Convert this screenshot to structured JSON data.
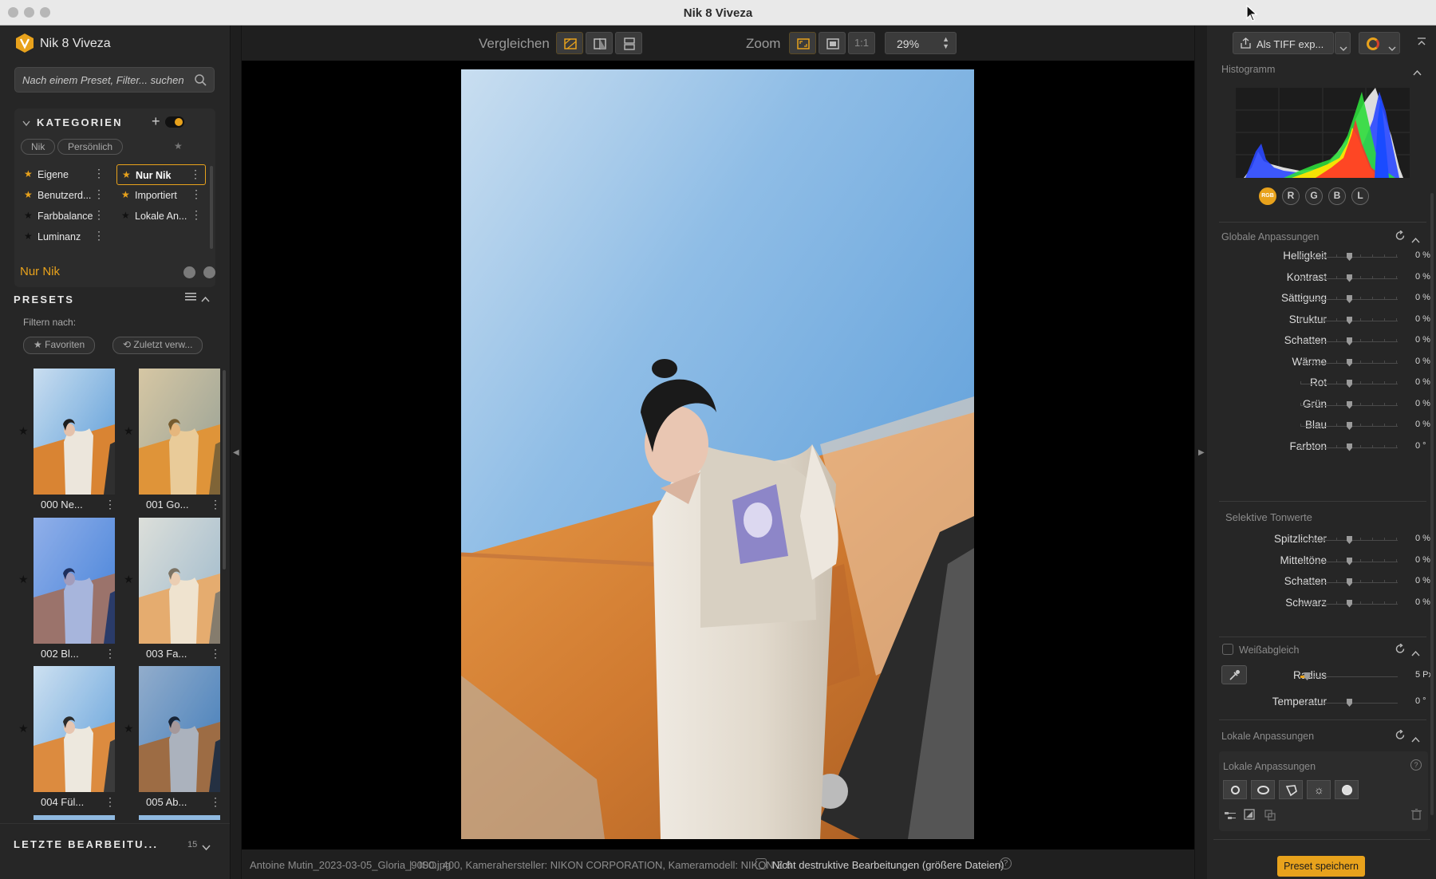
{
  "window": {
    "title": "Nik 8 Viveza"
  },
  "left": {
    "app_name": "Nik 8 Viveza",
    "search_placeholder": "Nach einem Preset, Filter... suchen",
    "categories_title": "KATEGORIEN",
    "chips": [
      "Nik",
      "Persönlich"
    ],
    "categories": [
      {
        "label": "Eigene",
        "star": "orange",
        "active": false
      },
      {
        "label": "Nur Nik",
        "star": "orange",
        "active": true
      },
      {
        "label": "Benutzerd...",
        "star": "orange",
        "active": false
      },
      {
        "label": "Importiert",
        "star": "orange",
        "active": false
      },
      {
        "label": "Farbbalance",
        "star": "dark",
        "active": false
      },
      {
        "label": "Lokale An...",
        "star": "dark",
        "active": false
      },
      {
        "label": "Luminanz",
        "star": "dark",
        "active": false
      }
    ],
    "current_category": "Nur Nik",
    "presets_title": "PRESETS",
    "filter_label": "Filtern nach:",
    "filter_chips": [
      "Favoriten",
      "Zuletzt verw..."
    ],
    "thumbnails": [
      {
        "label": "000 Ne...",
        "tone": "neutral"
      },
      {
        "label": "001 Go...",
        "tone": "gold"
      },
      {
        "label": "002 Bl...",
        "tone": "blue"
      },
      {
        "label": "003 Fa...",
        "tone": "faded"
      },
      {
        "label": "004 Fül...",
        "tone": "neutral"
      },
      {
        "label": "005 Ab...",
        "tone": "dark"
      }
    ],
    "recent_title": "LETZTE BEARBEITU...",
    "recent_count": "15"
  },
  "toolbar": {
    "compare_label": "Vergleichen",
    "zoom_label": "Zoom",
    "zoom_one_to_one": "1:1",
    "zoom_value": "29%"
  },
  "status": {
    "filename": "Antoine Mutin_2023-03-05_Gloria_9000.jpg",
    "separator": "|",
    "exif": "ISO: 400, Kamerahersteller: NIKON CORPORATION, Kameramodell: NIKON Z 6",
    "nondestructive_label": "Nicht destruktive Bearbeitungen (größere Dateien)",
    "help": "?"
  },
  "right": {
    "export_label": "Als TIFF exp...",
    "histogram_title": "Histogramm",
    "histogram_channels": [
      "RGB",
      "R",
      "G",
      "B",
      "L"
    ],
    "global_title": "Globale Anpassungen",
    "global_sliders": [
      {
        "label": "Helligkeit",
        "value": "0 %"
      },
      {
        "label": "Kontrast",
        "value": "0 %"
      },
      {
        "label": "Sättigung",
        "value": "0 %"
      },
      {
        "label": "Struktur",
        "value": "0 %"
      },
      {
        "label": "Schatten",
        "value": "0 %"
      },
      {
        "label": "Wärme",
        "value": "0 %"
      },
      {
        "label": "Rot",
        "value": "0 %"
      },
      {
        "label": "Grün",
        "value": "0 %"
      },
      {
        "label": "Blau",
        "value": "0 %"
      },
      {
        "label": "Farbton",
        "value": "0 °"
      }
    ],
    "selective_title": "Selektive Tonwerte",
    "selective_sliders": [
      {
        "label": "Spitzlichter",
        "value": "0 %"
      },
      {
        "label": "Mitteltöne",
        "value": "0 %"
      },
      {
        "label": "Schatten",
        "value": "0 %"
      },
      {
        "label": "Schwarz",
        "value": "0 %"
      }
    ],
    "wb_title": "Weißabgleich",
    "wb_radius_label": "Radius",
    "wb_radius_value": "5 Px",
    "wb_temp_label": "Temperatur",
    "wb_temp_value": "0 °",
    "local_title": "Lokale Anpassungen",
    "local_subtitle": "Lokale Anpassungen",
    "local_help": "?",
    "save_preset": "Preset speichern"
  },
  "colors": {
    "accent": "#e8a21c",
    "panel": "#262626",
    "canvas": "#000000"
  }
}
